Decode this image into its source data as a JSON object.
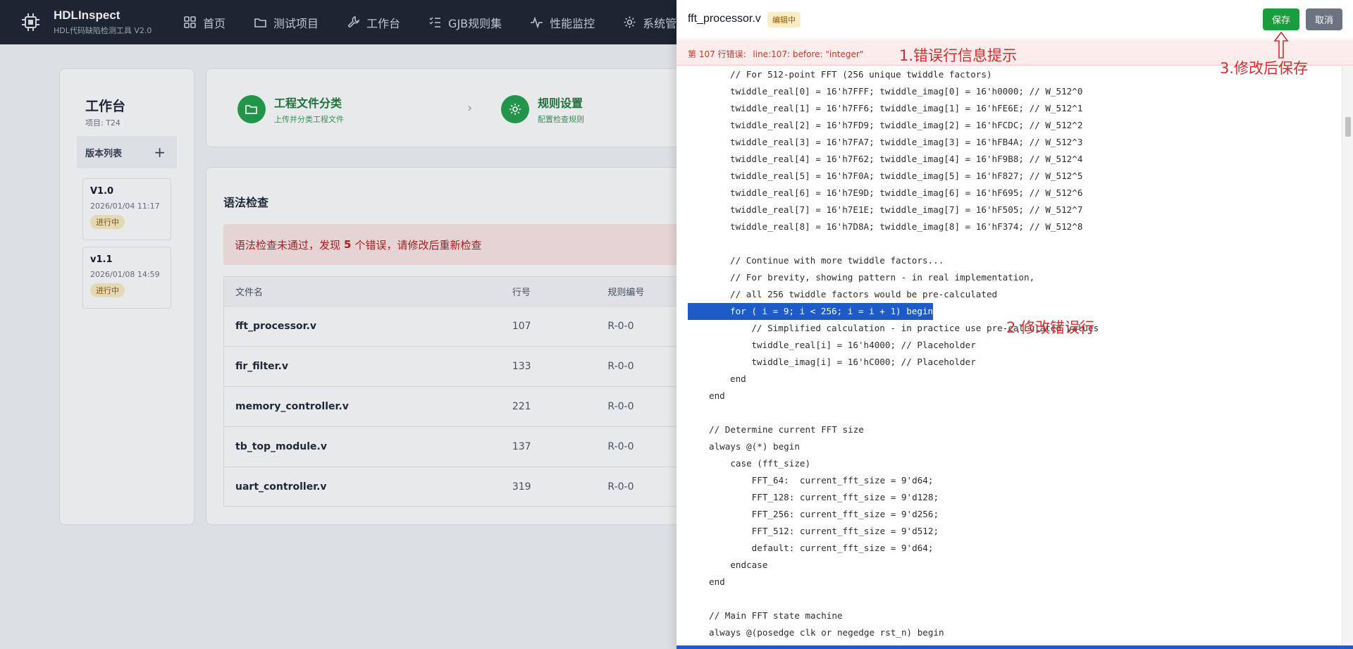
{
  "app": {
    "title": "HDLInspect",
    "subtitle": "HDL代码缺陷检测工具 V2.0"
  },
  "nav": [
    {
      "label": "首页",
      "icon": "grid-icon"
    },
    {
      "label": "测试项目",
      "icon": "folder-icon"
    },
    {
      "label": "工作台",
      "icon": "wrench-icon"
    },
    {
      "label": "GJB规则集",
      "icon": "list-check-icon"
    },
    {
      "label": "性能监控",
      "icon": "pulse-icon"
    },
    {
      "label": "系统管",
      "icon": "gear-icon"
    }
  ],
  "workbench": {
    "title": "工作台",
    "project": "项目: T24",
    "versions_label": "版本列表",
    "add_label": "+",
    "versions": [
      {
        "name": "V1.0",
        "date": "2026/01/04 11:17",
        "status": "进行中"
      },
      {
        "name": "v1.1",
        "date": "2026/01/08 14:59",
        "status": "进行中"
      }
    ]
  },
  "steps": [
    {
      "title": "工程文件分类",
      "sub": "上传并分类工程文件"
    },
    {
      "title": "规则设置",
      "sub": "配置检查规则"
    }
  ],
  "syntax": {
    "title": "语法检查",
    "alert_pre": "语法检查未通过，发现",
    "alert_count": "5",
    "alert_post": "个错误，请修改后重新检查",
    "columns": [
      "文件名",
      "行号",
      "规则编号"
    ],
    "rows": [
      {
        "file": "fft_processor.v",
        "line": "107",
        "rule": "R-0-0"
      },
      {
        "file": "fir_filter.v",
        "line": "133",
        "rule": "R-0-0"
      },
      {
        "file": "memory_controller.v",
        "line": "221",
        "rule": "R-0-0"
      },
      {
        "file": "tb_top_module.v",
        "line": "137",
        "rule": "R-0-0"
      },
      {
        "file": "uart_controller.v",
        "line": "319",
        "rule": "R-0-0"
      }
    ]
  },
  "editor": {
    "file": "fft_processor.v",
    "badge": "编辑中",
    "save_label": "保存",
    "cancel_label": "取消",
    "error_prefix": "第 107 行错误:",
    "error_msg": "line:107: before: \"integer\"",
    "highlight_index": 14,
    "lines": [
      "// For 512-point FFT (256 unique twiddle factors)",
      "twiddle_real[0] = 16'h7FFF; twiddle_imag[0] = 16'h0000; // W_512^0",
      "twiddle_real[1] = 16'h7FF6; twiddle_imag[1] = 16'hFE6E; // W_512^1",
      "twiddle_real[2] = 16'h7FD9; twiddle_imag[2] = 16'hFCDC; // W_512^2",
      "twiddle_real[3] = 16'h7FA7; twiddle_imag[3] = 16'hFB4A; // W_512^3",
      "twiddle_real[4] = 16'h7F62; twiddle_imag[4] = 16'hF9B8; // W_512^4",
      "twiddle_real[5] = 16'h7F0A; twiddle_imag[5] = 16'hF827; // W_512^5",
      "twiddle_real[6] = 16'h7E9D; twiddle_imag[6] = 16'hF695; // W_512^6",
      "twiddle_real[7] = 16'h7E1E; twiddle_imag[7] = 16'hF505; // W_512^7",
      "twiddle_real[8] = 16'h7D8A; twiddle_imag[8] = 16'hF374; // W_512^8",
      "",
      "// Continue with more twiddle factors...",
      "// For brevity, showing pattern - in real implementation,",
      "// all 256 twiddle factors would be pre-calculated",
      "for ( i = 9; i < 256; i = i + 1) begin",
      "    // Simplified calculation - in practice use pre-calculated values",
      "    twiddle_real[i] = 16'h4000; // Placeholder",
      "    twiddle_imag[i] = 16'hC000; // Placeholder",
      "end",
      "end",
      "",
      "// Determine current FFT size",
      "always @(*) begin",
      "    case (fft_size)",
      "        FFT_64:  current_fft_size = 9'd64;",
      "        FFT_128: current_fft_size = 9'd128;",
      "        FFT_256: current_fft_size = 9'd256;",
      "        FFT_512: current_fft_size = 9'd512;",
      "        default: current_fft_size = 9'd64;",
      "    endcase",
      "end",
      "",
      "// Main FFT state machine",
      "always @(posedge clk or negedge rst_n) begin"
    ],
    "indents": [
      1,
      1,
      1,
      1,
      1,
      1,
      1,
      1,
      1,
      1,
      1,
      1,
      1,
      1,
      1,
      1,
      1,
      1,
      1,
      0,
      0,
      0,
      0,
      0,
      0,
      0,
      0,
      0,
      0,
      0,
      0,
      0,
      0,
      0
    ]
  },
  "annotations": {
    "a1": "1.错误行信息提示",
    "a2": "2.修改错误行",
    "a3": "3.修改后保存"
  },
  "colors": {
    "nav_bg": "#1d2533",
    "accent_green": "#1a9e3d",
    "error_red": "#c0392b",
    "highlight_blue": "#1e5bc6"
  }
}
